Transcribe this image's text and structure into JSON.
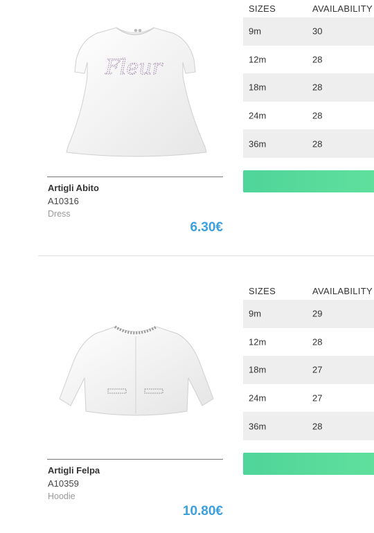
{
  "products": [
    {
      "name": "Artigli Abito",
      "code": "A10316",
      "category": "Dress",
      "price": "6.30€",
      "image_print_text": "Fleur",
      "table": {
        "header_size": "SIZES",
        "header_availability": "AVAILABILITY",
        "rows": [
          {
            "size": "9m",
            "availability": "30"
          },
          {
            "size": "12m",
            "availability": "28"
          },
          {
            "size": "18m",
            "availability": "28"
          },
          {
            "size": "24m",
            "availability": "28"
          },
          {
            "size": "36m",
            "availability": "28"
          }
        ]
      },
      "button_color": "#56db9b"
    },
    {
      "name": "Artigli Felpa",
      "code": "A10359",
      "category": "Hoodie",
      "price": "10.80€",
      "table": {
        "header_size": "SIZES",
        "header_availability": "AVAILABILITY",
        "rows": [
          {
            "size": "9m",
            "availability": "29"
          },
          {
            "size": "12m",
            "availability": "28"
          },
          {
            "size": "18m",
            "availability": "27"
          },
          {
            "size": "24m",
            "availability": "27"
          },
          {
            "size": "36m",
            "availability": "28"
          }
        ]
      },
      "button_color": "#56db9b"
    }
  ],
  "colors": {
    "price": "#3ba0dd",
    "row_alt": "#eeeeee",
    "button": "#56db9b"
  }
}
